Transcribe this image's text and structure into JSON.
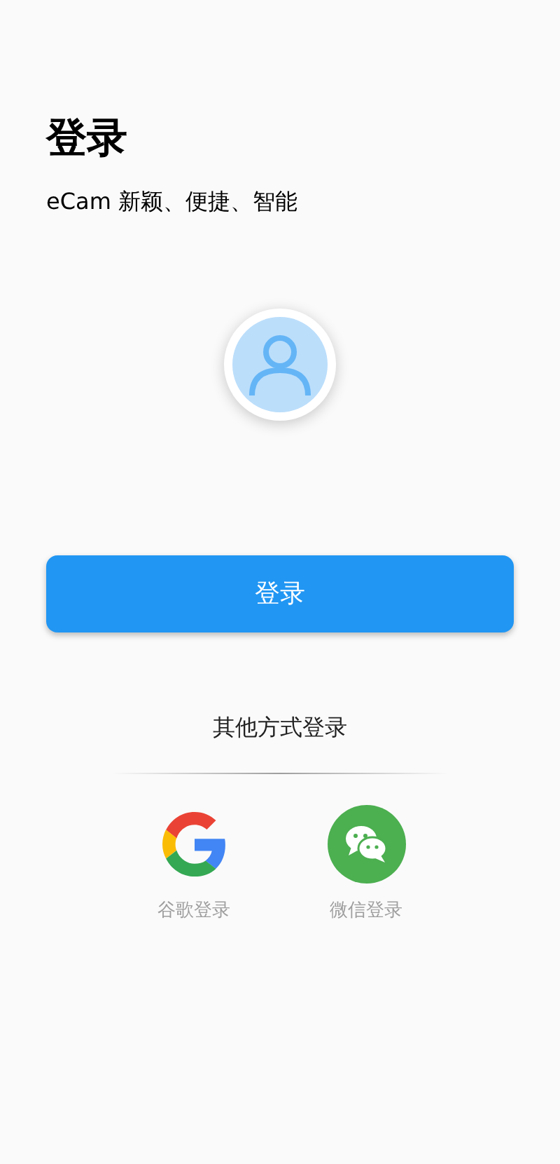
{
  "title": "登录",
  "subtitle": "eCam 新颖、便捷、智能",
  "login_button": "登录",
  "other_methods": {
    "heading": "其他方式登录",
    "options": [
      {
        "kind": "google",
        "label": "谷歌登录"
      },
      {
        "kind": "wechat",
        "label": "微信登录"
      }
    ]
  }
}
